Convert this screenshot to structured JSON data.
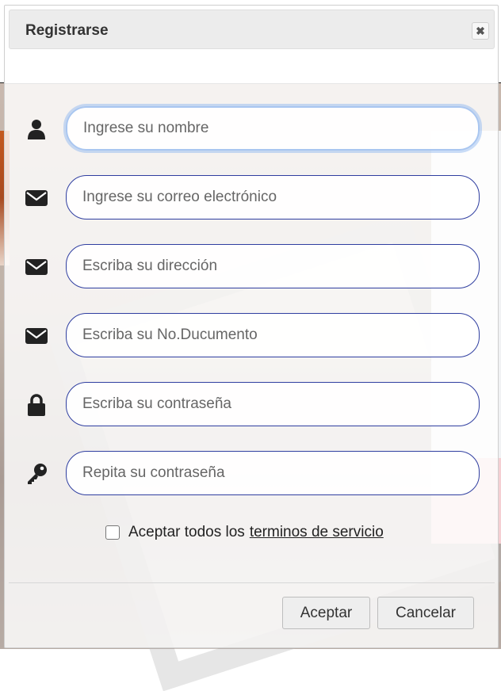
{
  "modal": {
    "title": "Registrarse",
    "close_icon": "close-icon"
  },
  "fields": [
    {
      "icon": "user-icon",
      "placeholder": "Ingrese su nombre"
    },
    {
      "icon": "envelope-icon",
      "placeholder": "Ingrese su correo electrónico"
    },
    {
      "icon": "envelope-icon",
      "placeholder": "Escriba su dirección"
    },
    {
      "icon": "envelope-icon",
      "placeholder": "Escriba su No.Ducumento"
    },
    {
      "icon": "lock-icon",
      "placeholder": "Escriba su contraseña"
    },
    {
      "icon": "key-icon",
      "placeholder": "Repita su contraseña"
    }
  ],
  "terms": {
    "checked": false,
    "text": "Aceptar todos los",
    "link_text": "terminos de servicio"
  },
  "buttons": {
    "accept": "Aceptar",
    "cancel": "Cancelar"
  },
  "colors": {
    "field_border": "#2f3ea0",
    "focus_ring": "#a9c6f0",
    "header_bg": "#ececec"
  }
}
